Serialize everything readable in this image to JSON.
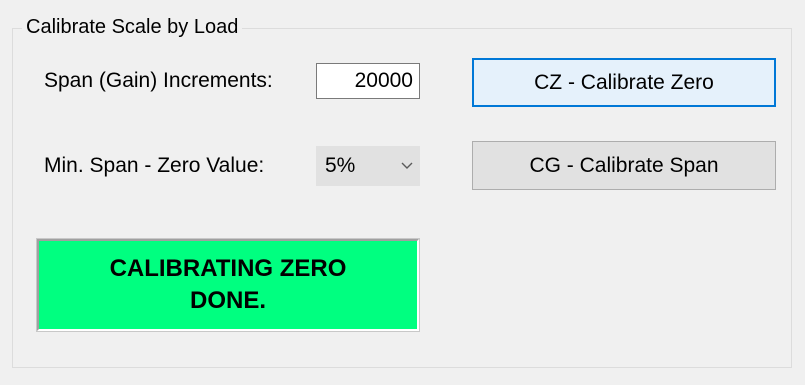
{
  "group": {
    "title": "Calibrate Scale by Load"
  },
  "span_increments": {
    "label": "Span (Gain) Increments:",
    "value": "20000"
  },
  "min_span": {
    "label": "Min. Span - Zero Value:",
    "selected": "5%",
    "arrow_icon": "chevron-down-icon"
  },
  "buttons": {
    "calibrate_zero": "CZ - Calibrate Zero",
    "calibrate_span": "CG - Calibrate Span"
  },
  "status": {
    "line1": "CALIBRATING ZERO",
    "line2": "DONE.",
    "color": "#00ff80"
  },
  "colors": {
    "background": "#f0f0f0",
    "focus_accent": "#0078d7"
  }
}
